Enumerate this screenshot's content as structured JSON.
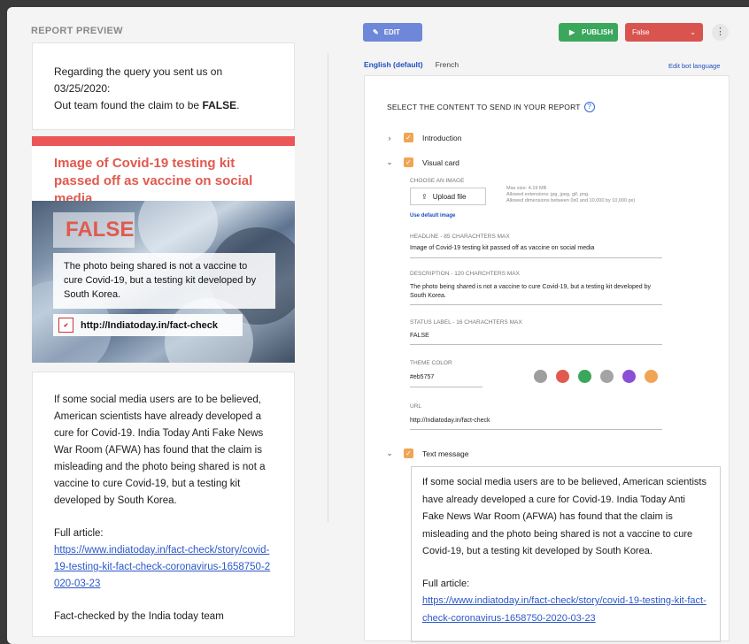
{
  "preview": {
    "title": "REPORT PREVIEW",
    "intro": {
      "line1": "Regarding the query you sent us on",
      "line2": "03/25/2020:",
      "line3_prefix": "Out team found the claim to be ",
      "line3_bold": "FALSE",
      "line3_suffix": "."
    },
    "visual_card": {
      "headline": "Image of Covid-19 testing kit passed off as vaccine on social media",
      "status": "FALSE",
      "description": "The photo being shared is not a vaccine to cure Covid-19, but a testing kit developed by South Korea.",
      "url": "http://Indiatoday.in/fact-check",
      "theme_color": "#eb5757"
    },
    "text_message": {
      "body": "If some social media users are to be believed, American scientists have already developed a cure for Covid-19. India Today Anti Fake News War Room (AFWA) has found that the claim is misleading and the photo being shared is not a vaccine to cure Covid-19, but a testing kit developed by South Korea.",
      "full_article_label": "Full article:",
      "link": "https://www.indiatoday.in/fact-check/story/covid-19-testing-kit-fact-check-coronavirus-1658750-2020-03-23",
      "signature": "Fact-checked by the India today team"
    }
  },
  "toolbar": {
    "edit_label": "EDIT",
    "publish_label": "PUBLISH",
    "status_value": "False"
  },
  "languages": {
    "active": "English (default)",
    "other": "French",
    "edit_link": "Edit bot language"
  },
  "editor": {
    "title": "SELECT THE CONTENT TO SEND IN YOUR REPORT",
    "sections": {
      "introduction": "Introduction",
      "visual_card": "Visual card",
      "text_message": "Text message"
    },
    "image": {
      "label": "CHOOSE AN IMAGE",
      "upload_label": "Upload file",
      "max_size": "Max size: 4.19 MB",
      "extensions": "Allowed extensions: jpg, jpeg, gif, png.",
      "dimensions": "Allowed dimensions between 0x0 and 10,000 by 10,000 px)",
      "default_link": "Use default image"
    },
    "fields": {
      "headline_label": "HEADLINE - 85 CHARACHTERS MAX",
      "headline_value": "Image of Covid-19 testing kit passed off as vaccine on social media",
      "description_label": "DESCRIPTION - 120 CHARCHTERS MAX",
      "description_value": "The photo being shared is not a vaccine to cure Covid-19, but a testing kit developed by South Korea.",
      "status_label": "STATUS LABEL - 16 CHARACHTERS MAX",
      "status_value": "FALSE",
      "theme_label": "THEME COLOR",
      "theme_value": "#eb5757",
      "url_label": "URL",
      "url_value": "http://Indiatoday.in/fact-check"
    },
    "swatches": [
      "#9e9e9e",
      "#e05a4f",
      "#3aa75c",
      "#a4a4a4",
      "#8a4fd6",
      "#f0a555"
    ]
  }
}
